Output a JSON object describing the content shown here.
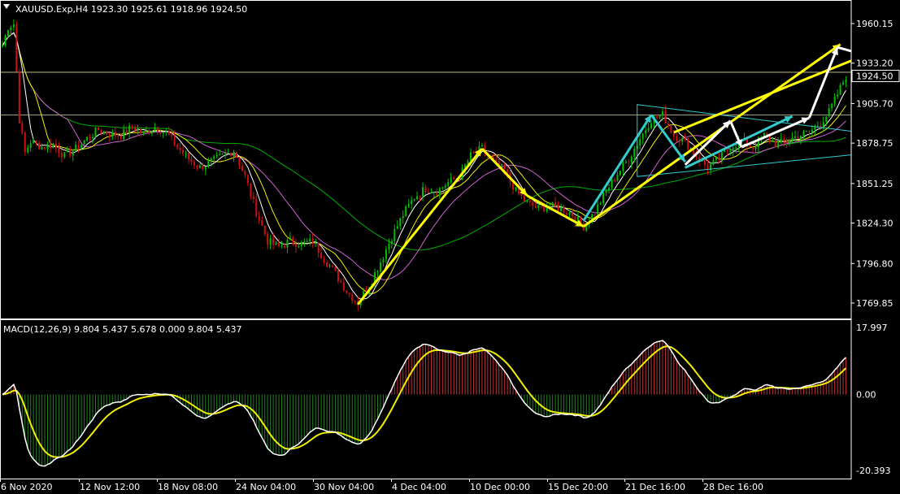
{
  "header": {
    "symbol_line": "XAUUSD.Exp,H4  1923.30 1925.61 1918.96 1924.50",
    "macd_line": "MACD(12,26,9) 9.804 5.437 5.678 0.000 9.804 5.437"
  },
  "colors": {
    "background": "#000000",
    "frame": "#ffffff",
    "bull_candle": "#00c000",
    "bear_candle": "#d01010",
    "hline": "#d8d8a0",
    "ma_green": "#00b000",
    "ma_violet": "#d060d0",
    "ma_yellow": "#f0f000",
    "ma_white": "#ffffff",
    "yellow_arrow": "#ffff00",
    "cyan_arrow": "#33cccc",
    "white_arrow": "#ffffff",
    "triangle": "#33cccc",
    "macd_pos": "#c03030",
    "macd_neg": "#208020",
    "current_price_box": "#ffffff"
  },
  "chart_data": [
    {
      "type": "candlestick",
      "title": "XAUUSD.Exp,H4",
      "ohlc_last": {
        "open": 1923.3,
        "high": 1925.61,
        "low": 1918.96,
        "close": 1924.5
      },
      "y_ticks": [
        1960.15,
        1933.2,
        1905.7,
        1878.75,
        1851.25,
        1824.3,
        1796.8,
        1769.85
      ],
      "current_price": "1924.50",
      "ylim": [
        1758,
        1969
      ],
      "x_ticks": [
        "6 Nov 2020",
        "12 Nov 12:00",
        "18 Nov 08:00",
        "24 Nov 04:00",
        "30 Nov 04:00",
        "4 Dec 04:00",
        "10 Dec 00:00",
        "15 Dec 20:00",
        "21 Dec 16:00",
        "28 Dec 16:00"
      ],
      "close_path": [
        [
          0,
          1945
        ],
        [
          2,
          1958
        ],
        [
          4,
          1960
        ],
        [
          6,
          1895
        ],
        [
          8,
          1872
        ],
        [
          10,
          1880
        ],
        [
          14,
          1876
        ],
        [
          18,
          1878
        ],
        [
          22,
          1870
        ],
        [
          26,
          1875
        ],
        [
          30,
          1882
        ],
        [
          34,
          1888
        ],
        [
          38,
          1885
        ],
        [
          42,
          1884
        ],
        [
          46,
          1890
        ],
        [
          50,
          1885
        ],
        [
          54,
          1890
        ],
        [
          58,
          1886
        ],
        [
          62,
          1876
        ],
        [
          66,
          1868
        ],
        [
          70,
          1862
        ],
        [
          74,
          1866
        ],
        [
          78,
          1870
        ],
        [
          82,
          1874
        ],
        [
          86,
          1856
        ],
        [
          90,
          1832
        ],
        [
          94,
          1812
        ],
        [
          98,
          1808
        ],
        [
          102,
          1812
        ],
        [
          106,
          1810
        ],
        [
          110,
          1812
        ],
        [
          114,
          1800
        ],
        [
          118,
          1790
        ],
        [
          122,
          1778
        ],
        [
          126,
          1770
        ],
        [
          130,
          1782
        ],
        [
          134,
          1798
        ],
        [
          138,
          1815
        ],
        [
          142,
          1830
        ],
        [
          146,
          1842
        ],
        [
          150,
          1848
        ],
        [
          154,
          1846
        ],
        [
          158,
          1852
        ],
        [
          162,
          1856
        ],
        [
          166,
          1870
        ],
        [
          170,
          1875
        ],
        [
          174,
          1866
        ],
        [
          178,
          1860
        ],
        [
          182,
          1846
        ],
        [
          186,
          1838
        ],
        [
          190,
          1834
        ],
        [
          194,
          1836
        ],
        [
          198,
          1834
        ],
        [
          202,
          1830
        ],
        [
          206,
          1822
        ],
        [
          210,
          1832
        ],
        [
          214,
          1846
        ],
        [
          218,
          1858
        ],
        [
          222,
          1868
        ],
        [
          226,
          1882
        ],
        [
          230,
          1895
        ],
        [
          234,
          1898
        ],
        [
          238,
          1884
        ],
        [
          242,
          1880
        ],
        [
          246,
          1870
        ],
        [
          250,
          1862
        ],
        [
          254,
          1868
        ],
        [
          258,
          1876
        ],
        [
          262,
          1880
        ],
        [
          266,
          1876
        ],
        [
          270,
          1884
        ],
        [
          274,
          1878
        ],
        [
          278,
          1880
        ],
        [
          282,
          1884
        ],
        [
          286,
          1886
        ],
        [
          290,
          1893
        ],
        [
          293,
          1900
        ],
        [
          296,
          1912
        ],
        [
          299,
          1924.5
        ]
      ],
      "hlines": [
        1927,
        1898
      ],
      "macd": {
        "label": "MACD(12,26,9)",
        "values": [
          9.804,
          5.437,
          5.678,
          0.0,
          9.804,
          5.437
        ],
        "y_ticks": [
          "17.997",
          "0.00",
          "-20.393"
        ],
        "ylim": [
          -20.393,
          17.997
        ]
      }
    }
  ]
}
